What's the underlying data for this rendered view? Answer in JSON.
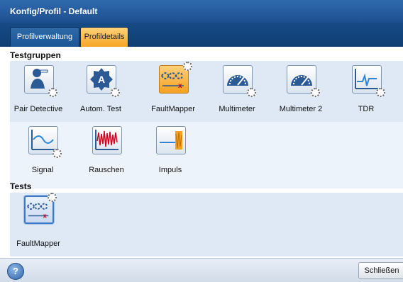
{
  "window": {
    "title": "Konfig/Profil - Default"
  },
  "tabs": [
    {
      "label": "Profilverwaltung"
    },
    {
      "label": "Profildetails"
    }
  ],
  "testgruppen": {
    "heading": "Testgruppen",
    "items": [
      {
        "label": "Pair Detective",
        "icon": "technician-icon"
      },
      {
        "label": "Autom. Test",
        "icon": "auto-test-badge-icon"
      },
      {
        "label": "FaultMapper",
        "icon": "faultmapper-icon"
      },
      {
        "label": "Multimeter",
        "icon": "gauge-icon"
      },
      {
        "label": "Multimeter 2",
        "icon": "gauge-icon"
      },
      {
        "label": "TDR",
        "icon": "tdr-trace-icon"
      },
      {
        "label": "Signal",
        "icon": "signal-curve-icon"
      },
      {
        "label": "Rauschen",
        "icon": "noise-icon"
      },
      {
        "label": "Impuls",
        "icon": "impulse-icon"
      }
    ]
  },
  "tests": {
    "heading": "Tests",
    "items": [
      {
        "label": "FaultMapper",
        "icon": "faultmapper-icon"
      }
    ]
  },
  "footer": {
    "help": "?",
    "close_label": "Schließen"
  },
  "colors": {
    "titlebar": "#1d4f8f",
    "active_tab": "#f6a623",
    "row": "#dfe9f5"
  }
}
